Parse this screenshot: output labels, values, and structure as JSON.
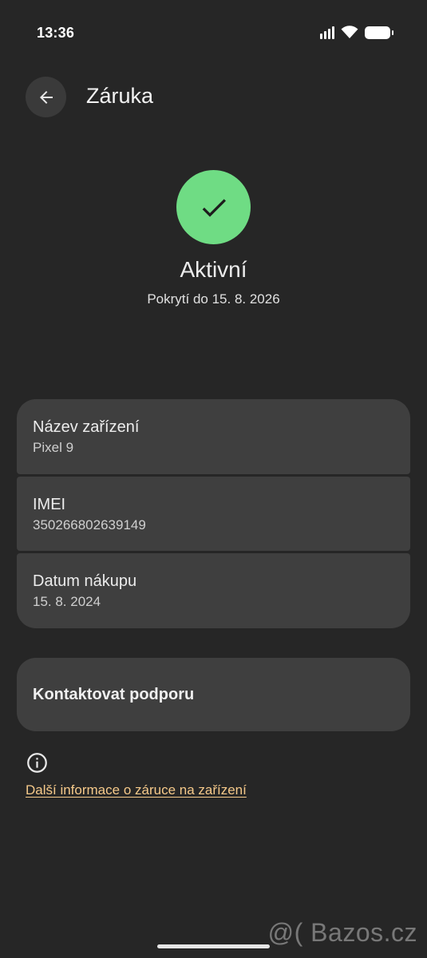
{
  "status_bar": {
    "time": "13:36",
    "signal_icon": "signal-bars-icon",
    "wifi_icon": "wifi-icon",
    "battery_icon": "battery-full-icon"
  },
  "header": {
    "back_icon": "arrow-left-icon",
    "title": "Záruka"
  },
  "warranty_status": {
    "icon": "checkmark-icon",
    "status": "Aktivní",
    "coverage": "Pokrytí do 15. 8. 2026",
    "accent_color": "#6fdc84"
  },
  "details": [
    {
      "label": "Název zařízení",
      "value": "Pixel 9"
    },
    {
      "label": "IMEI",
      "value": "350266802639149"
    },
    {
      "label": "Datum nákupu",
      "value": "15. 8. 2024"
    }
  ],
  "contact": {
    "label": "Kontaktovat podporu"
  },
  "info": {
    "icon": "info-icon",
    "link_text": "Další informace o záruce na zařízení",
    "link_color": "#f5c98a"
  },
  "watermark": "@( Bazos.cz"
}
